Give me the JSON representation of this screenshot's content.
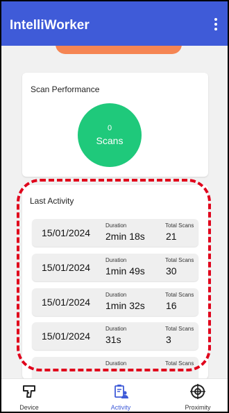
{
  "app_bar": {
    "title": "IntelliWorker",
    "menu_icon": "more-vert-icon"
  },
  "colors": {
    "app_bar": "#3f5bd8",
    "scan_circle": "#1fc97b",
    "accent_orange": "#f58553",
    "highlight": "#e0001b",
    "active_nav": "#3f5bd8"
  },
  "scan_performance": {
    "title": "Scan Performance",
    "count": "0",
    "unit": "Scans"
  },
  "last_activity": {
    "title": "Last Activity",
    "rows": [
      {
        "date": "15/01/2024",
        "duration_label": "Duration",
        "duration": "2min 18s",
        "scans_label": "Total Scans",
        "scans": "21"
      },
      {
        "date": "15/01/2024",
        "duration_label": "Duration",
        "duration": "1min 49s",
        "scans_label": "Total Scans",
        "scans": "30"
      },
      {
        "date": "15/01/2024",
        "duration_label": "Duration",
        "duration": "1min 32s",
        "scans_label": "Total Scans",
        "scans": "16"
      },
      {
        "date": "15/01/2024",
        "duration_label": "Duration",
        "duration": "31s",
        "scans_label": "Total Scans",
        "scans": "3"
      },
      {
        "date": "",
        "duration_label": "Duration",
        "duration": "",
        "scans_label": "Total Scans",
        "scans": ""
      }
    ]
  },
  "bottom_nav": {
    "items": [
      {
        "label": "Device",
        "icon": "scanner-gun-icon"
      },
      {
        "label": "Activity",
        "icon": "activity-clipboard-icon",
        "active": true
      },
      {
        "label": "Proximity",
        "icon": "proximity-radar-icon"
      }
    ]
  }
}
